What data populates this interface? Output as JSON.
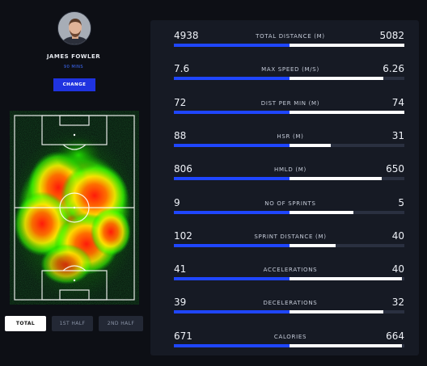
{
  "player": {
    "name": "JAMES FOWLER",
    "minutes": "90 MINS",
    "change_label": "CHANGE"
  },
  "tabs": [
    {
      "label": "TOTAL",
      "active": true
    },
    {
      "label": "1ST HALF",
      "active": false
    },
    {
      "label": "2ND HALF",
      "active": false
    }
  ],
  "colors": {
    "accent_blue": "#1f46ff",
    "compare_white": "#ffffff",
    "panel": "#161a24",
    "background": "#0d0f15"
  },
  "stats": [
    {
      "label": "TOTAL DISTANCE (M)",
      "left": "4938",
      "right": "5082",
      "left_frac": 0.5,
      "right_frac": 0.5
    },
    {
      "label": "MAX SPEED (M/S)",
      "left": "7.6",
      "right": "6.26",
      "left_frac": 0.5,
      "right_frac": 0.41
    },
    {
      "label": "DIST PER MIN (M)",
      "left": "72",
      "right": "74",
      "left_frac": 0.5,
      "right_frac": 0.5
    },
    {
      "label": "HSR (M)",
      "left": "88",
      "right": "31",
      "left_frac": 0.5,
      "right_frac": 0.18
    },
    {
      "label": "HMLD (M)",
      "left": "806",
      "right": "650",
      "left_frac": 0.5,
      "right_frac": 0.4
    },
    {
      "label": "NO OF SPRINTS",
      "left": "9",
      "right": "5",
      "left_frac": 0.5,
      "right_frac": 0.28
    },
    {
      "label": "SPRINT DISTANCE (M)",
      "left": "102",
      "right": "40",
      "left_frac": 0.5,
      "right_frac": 0.2
    },
    {
      "label": "ACCELERATIONS",
      "left": "41",
      "right": "40",
      "left_frac": 0.5,
      "right_frac": 0.49
    },
    {
      "label": "DECELERATIONS",
      "left": "39",
      "right": "32",
      "left_frac": 0.5,
      "right_frac": 0.41
    },
    {
      "label": "CALORIES",
      "left": "671",
      "right": "664",
      "left_frac": 0.5,
      "right_frac": 0.49
    }
  ]
}
